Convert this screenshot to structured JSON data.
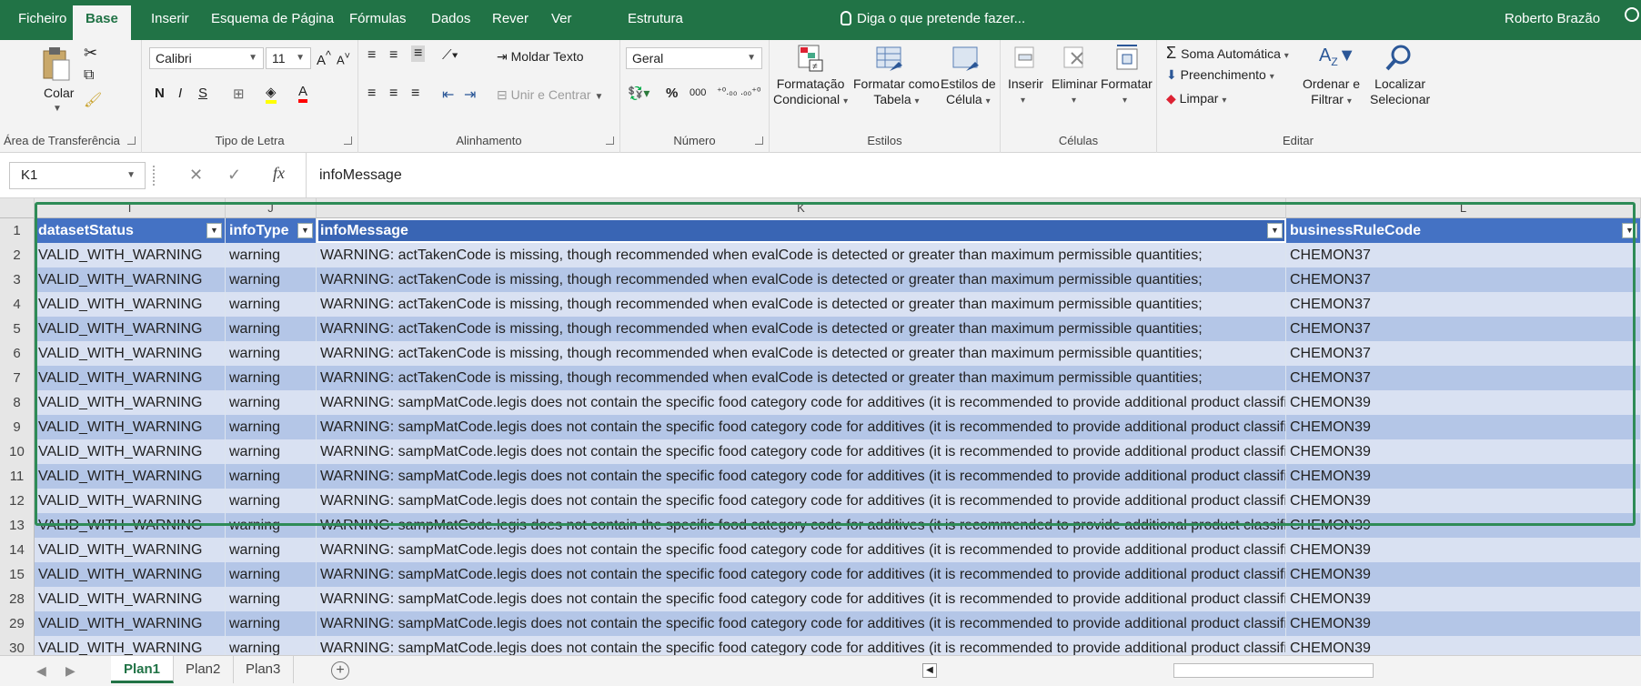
{
  "tabs": [
    "Ficheiro",
    "Base",
    "Inserir",
    "Esquema de Página",
    "Fórmulas",
    "Dados",
    "Rever",
    "Ver",
    "Estrutura"
  ],
  "tell_me": "Diga o que pretende fazer...",
  "user": "Roberto Brazão",
  "ribbon": {
    "clipboard": {
      "paste": "Colar",
      "label": "Área de Transferência"
    },
    "font": {
      "name": "Calibri",
      "size": "11",
      "label": "Tipo de Letra"
    },
    "alignment": {
      "wrap": "Moldar Texto",
      "merge": "Unir e Centrar",
      "label": "Alinhamento"
    },
    "number": {
      "format": "Geral",
      "label": "Número"
    },
    "styles": {
      "conditional": "Formatação",
      "conditional2": "Condicional",
      "as_table": "Formatar como",
      "as_table2": "Tabela",
      "cell_styles": "Estilos de",
      "cell_styles2": "Célula",
      "label": "Estilos"
    },
    "cells": {
      "insert": "Inserir",
      "delete": "Eliminar",
      "format": "Formatar",
      "label": "Células"
    },
    "editing": {
      "autosum": "Soma Automática",
      "fill": "Preenchimento",
      "clear": "Limpar",
      "sort": "Ordenar e",
      "sort2": "Filtrar",
      "find": "Localizar",
      "find2": "Selecionar",
      "label": "Editar"
    }
  },
  "formula_bar": {
    "cell_ref": "K1",
    "content": "infoMessage"
  },
  "columns": [
    "I",
    "J",
    "K",
    "L"
  ],
  "header_row": {
    "num": "1",
    "cells": [
      "datasetStatus",
      "infoType",
      "infoMessage",
      "businessRuleCode"
    ]
  },
  "rows": [
    {
      "num": "2",
      "status": "VALID_WITH_WARNING",
      "type": "warning",
      "message": "WARNING: actTakenCode is missing, though recommended when evalCode is detected or greater than maximum permissible quantities;",
      "code": "CHEMON37"
    },
    {
      "num": "3",
      "status": "VALID_WITH_WARNING",
      "type": "warning",
      "message": "WARNING: actTakenCode is missing, though recommended when evalCode is detected or greater than maximum permissible quantities;",
      "code": "CHEMON37"
    },
    {
      "num": "4",
      "status": "VALID_WITH_WARNING",
      "type": "warning",
      "message": "WARNING: actTakenCode is missing, though recommended when evalCode is detected or greater than maximum permissible quantities;",
      "code": "CHEMON37"
    },
    {
      "num": "5",
      "status": "VALID_WITH_WARNING",
      "type": "warning",
      "message": "WARNING: actTakenCode is missing, though recommended when evalCode is detected or greater than maximum permissible quantities;",
      "code": "CHEMON37"
    },
    {
      "num": "6",
      "status": "VALID_WITH_WARNING",
      "type": "warning",
      "message": "WARNING: actTakenCode is missing, though recommended when evalCode is detected or greater than maximum permissible quantities;",
      "code": "CHEMON37"
    },
    {
      "num": "7",
      "status": "VALID_WITH_WARNING",
      "type": "warning",
      "message": "WARNING: actTakenCode is missing, though recommended when evalCode is detected or greater than maximum permissible quantities;",
      "code": "CHEMON37"
    },
    {
      "num": "8",
      "status": "VALID_WITH_WARNING",
      "type": "warning",
      "message": "WARNING: sampMatCode.legis does not contain the specific food category code for additives (it is recommended to provide additional product classifi",
      "code": "CHEMON39"
    },
    {
      "num": "9",
      "status": "VALID_WITH_WARNING",
      "type": "warning",
      "message": "WARNING: sampMatCode.legis does not contain the specific food category code for additives (it is recommended to provide additional product classifi",
      "code": "CHEMON39"
    },
    {
      "num": "10",
      "status": "VALID_WITH_WARNING",
      "type": "warning",
      "message": "WARNING: sampMatCode.legis does not contain the specific food category code for additives (it is recommended to provide additional product classifi",
      "code": "CHEMON39"
    },
    {
      "num": "11",
      "status": "VALID_WITH_WARNING",
      "type": "warning",
      "message": "WARNING: sampMatCode.legis does not contain the specific food category code for additives (it is recommended to provide additional product classifi",
      "code": "CHEMON39"
    },
    {
      "num": "12",
      "status": "VALID_WITH_WARNING",
      "type": "warning",
      "message": "WARNING: sampMatCode.legis does not contain the specific food category code for additives (it is recommended to provide additional product classifi",
      "code": "CHEMON39"
    },
    {
      "num": "13",
      "status": "VALID_WITH_WARNING",
      "type": "warning",
      "message": "WARNING: sampMatCode.legis does not contain the specific food category code for additives (it is recommended to provide additional product classifi",
      "code": "CHEMON39"
    },
    {
      "num": "14",
      "status": "VALID_WITH_WARNING",
      "type": "warning",
      "message": "WARNING: sampMatCode.legis does not contain the specific food category code for additives (it is recommended to provide additional product classifi",
      "code": "CHEMON39"
    },
    {
      "num": "15",
      "status": "VALID_WITH_WARNING",
      "type": "warning",
      "message": "WARNING: sampMatCode.legis does not contain the specific food category code for additives (it is recommended to provide additional product classifi",
      "code": "CHEMON39"
    },
    {
      "num": "28",
      "status": "VALID_WITH_WARNING",
      "type": "warning",
      "message": "WARNING: sampMatCode.legis does not contain the specific food category code for additives (it is recommended to provide additional product classifi",
      "code": "CHEMON39"
    },
    {
      "num": "29",
      "status": "VALID_WITH_WARNING",
      "type": "warning",
      "message": "WARNING: sampMatCode.legis does not contain the specific food category code for additives (it is recommended to provide additional product classifi",
      "code": "CHEMON39"
    },
    {
      "num": "30",
      "status": "VALID_WITH_WARNING",
      "type": "warning",
      "message": "WARNING: sampMatCode.legis does not contain the specific food category code for additives (it is recommended to provide additional product classifi",
      "code": "CHEMON39"
    }
  ],
  "sheets": [
    "Plan1",
    "Plan2",
    "Plan3"
  ],
  "colors": {
    "excel_green": "#217346",
    "table_header": "#4472c4",
    "band_light": "#d9e1f2",
    "band_dark": "#b4c6e7",
    "highlight": "#2e8b57"
  }
}
